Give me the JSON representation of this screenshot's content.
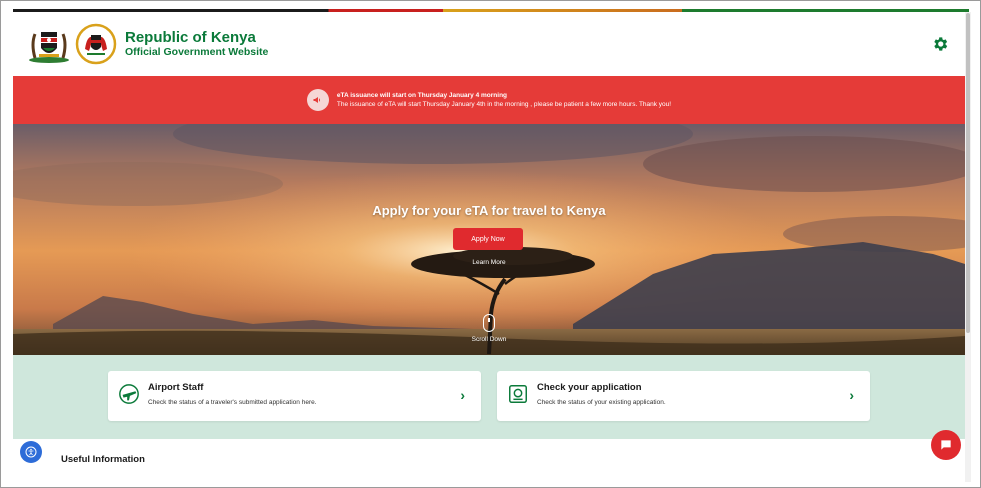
{
  "header": {
    "title": "Republic of Kenya",
    "subtitle": "Official Government Website",
    "logo_icon": "coat-of-arms-icon",
    "emblem_icon": "government-emblem-icon",
    "settings_icon": "gear-icon"
  },
  "alert": {
    "icon": "megaphone-icon",
    "title": "eTA issuance will start on Thursday January 4 morning",
    "body": "The issuance of eTA will start Thursday January 4th in the morning , please be patient a few more hours. Thank you!"
  },
  "hero": {
    "title": "Apply for your eTA for travel to Kenya",
    "apply_label": "Apply Now",
    "learn_label": "Learn More",
    "scroll_label": "Scroll Down"
  },
  "cards": [
    {
      "title": "Airport Staff",
      "desc": "Check the status of a traveler's submitted application here.",
      "icon": "airport-staff-icon"
    },
    {
      "title": "Check your application",
      "desc": "Check the status of your existing application.",
      "icon": "application-status-icon"
    }
  ],
  "footer": {
    "useful_title": "Useful Information",
    "accessibility_icon": "accessibility-icon",
    "chat_icon": "chat-icon"
  },
  "colors": {
    "brand_green": "#0b7a3a",
    "alert_red": "#e53b38",
    "button_red": "#e02a2e",
    "band_mint": "#cfe7dc"
  }
}
